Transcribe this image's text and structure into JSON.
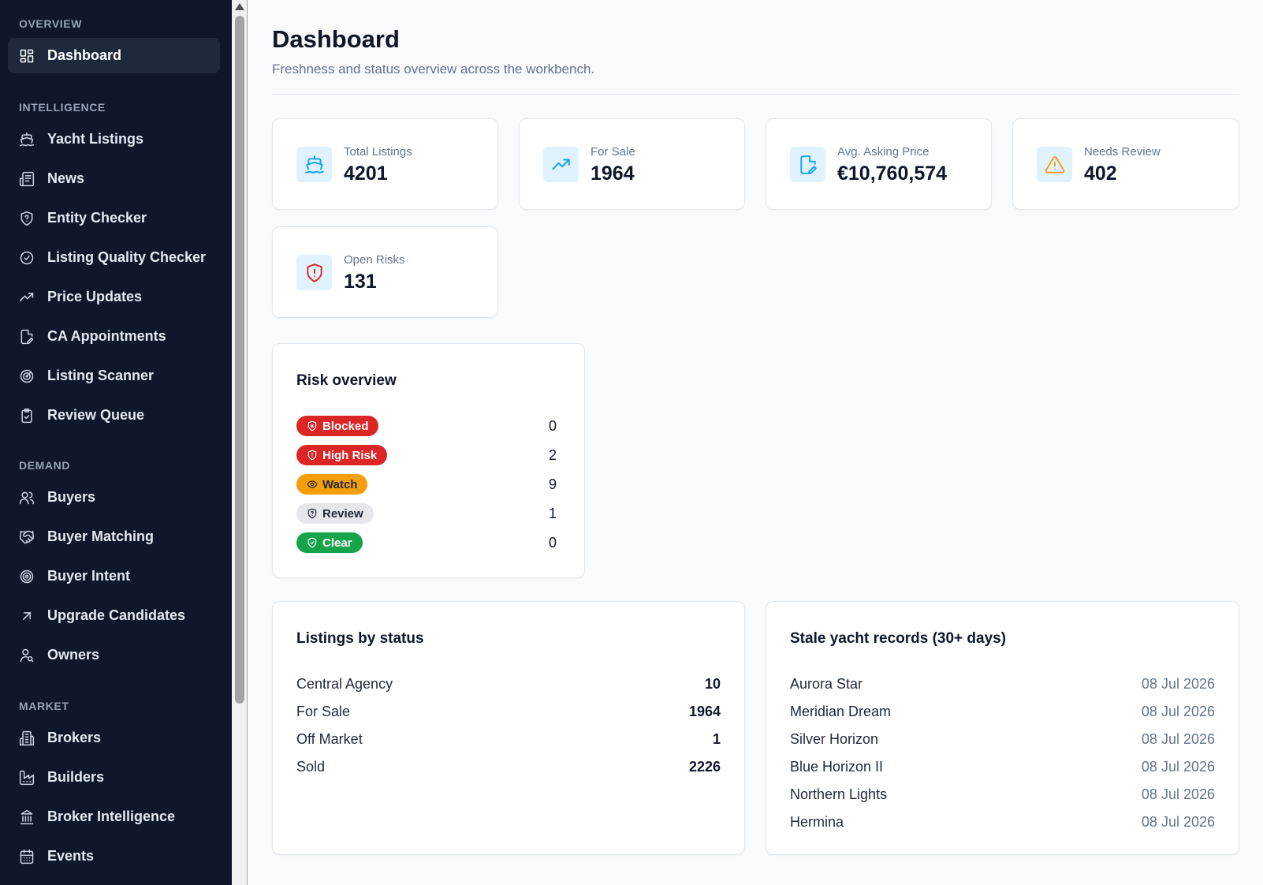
{
  "sidebar": {
    "sections": [
      {
        "label": "OVERVIEW",
        "items": [
          {
            "label": "Dashboard",
            "icon": "dashboard-grid-icon",
            "active": true
          }
        ]
      },
      {
        "label": "INTELLIGENCE",
        "items": [
          {
            "label": "Yacht Listings",
            "icon": "ship-icon"
          },
          {
            "label": "News",
            "icon": "newspaper-icon"
          },
          {
            "label": "Entity Checker",
            "icon": "shield-question-icon"
          },
          {
            "label": "Listing Quality Checker",
            "icon": "check-circle-icon"
          },
          {
            "label": "Price Updates",
            "icon": "trending-up-icon"
          },
          {
            "label": "CA Appointments",
            "icon": "file-edit-icon"
          },
          {
            "label": "Listing Scanner",
            "icon": "radar-icon"
          },
          {
            "label": "Review Queue",
            "icon": "clipboard-check-icon"
          }
        ]
      },
      {
        "label": "DEMAND",
        "items": [
          {
            "label": "Buyers",
            "icon": "users-icon"
          },
          {
            "label": "Buyer Matching",
            "icon": "handshake-icon"
          },
          {
            "label": "Buyer Intent",
            "icon": "target-icon"
          },
          {
            "label": "Upgrade Candidates",
            "icon": "arrow-up-right-icon"
          },
          {
            "label": "Owners",
            "icon": "user-search-icon"
          }
        ]
      },
      {
        "label": "MARKET",
        "items": [
          {
            "label": "Brokers",
            "icon": "building-icon"
          },
          {
            "label": "Builders",
            "icon": "factory-icon"
          },
          {
            "label": "Broker Intelligence",
            "icon": "landmark-icon"
          },
          {
            "label": "Events",
            "icon": "calendar-icon"
          }
        ]
      }
    ]
  },
  "header": {
    "title": "Dashboard",
    "subtitle": "Freshness and status overview across the workbench."
  },
  "stats": [
    {
      "label": "Total Listings",
      "value": "4201",
      "icon": "ship-icon",
      "color": "#0ea5e9"
    },
    {
      "label": "For Sale",
      "value": "1964",
      "icon": "trending-up-icon",
      "color": "#0ea5e9"
    },
    {
      "label": "Avg. Asking Price",
      "value": "€10,760,574",
      "icon": "file-edit-icon",
      "color": "#0ea5e9"
    },
    {
      "label": "Needs Review",
      "value": "402",
      "icon": "warning-triangle-icon",
      "color": "#f59e0b"
    },
    {
      "label": "Open Risks",
      "value": "131",
      "icon": "shield-alert-icon",
      "color": "#dc2626"
    }
  ],
  "risk_overview": {
    "title": "Risk overview",
    "rows": [
      {
        "label": "Blocked",
        "count": "0",
        "icon": "shield-x-icon",
        "bg": "#dc2626",
        "fg": "#ffffff"
      },
      {
        "label": "High Risk",
        "count": "2",
        "icon": "shield-alert-icon",
        "bg": "#dc2626",
        "fg": "#ffffff"
      },
      {
        "label": "Watch",
        "count": "9",
        "icon": "eye-icon",
        "bg": "#f59e0b",
        "fg": "#1f2937"
      },
      {
        "label": "Review",
        "count": "1",
        "icon": "shield-question-icon",
        "bg": "#e5e7eb",
        "fg": "#1f2937"
      },
      {
        "label": "Clear",
        "count": "0",
        "icon": "shield-check-icon",
        "bg": "#16a34a",
        "fg": "#ffffff"
      }
    ]
  },
  "listings_by_status": {
    "title": "Listings by status",
    "rows": [
      {
        "label": "Central Agency",
        "value": "10"
      },
      {
        "label": "For Sale",
        "value": "1964"
      },
      {
        "label": "Off Market",
        "value": "1"
      },
      {
        "label": "Sold",
        "value": "2226"
      }
    ]
  },
  "stale_records": {
    "title": "Stale yacht records (30+ days)",
    "rows": [
      {
        "name": "Aurora Star",
        "date": "08 Jul 2026"
      },
      {
        "name": "Meridian Dream",
        "date": "08 Jul 2026"
      },
      {
        "name": "Silver Horizon",
        "date": "08 Jul 2026"
      },
      {
        "name": "Blue Horizon II",
        "date": "08 Jul 2026"
      },
      {
        "name": "Northern Lights",
        "date": "08 Jul 2026"
      },
      {
        "name": "Hermina",
        "date": "08 Jul 2026"
      }
    ]
  }
}
